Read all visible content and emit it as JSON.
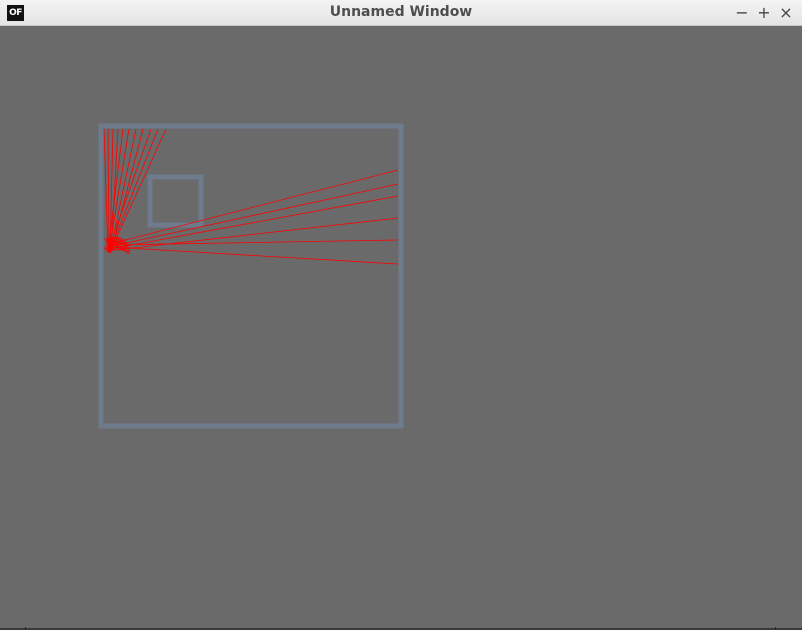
{
  "window": {
    "title": "Unnamed Window",
    "app_icon_text": "OF",
    "controls": {
      "minimize": "−",
      "maximize": "+",
      "close": "×"
    }
  },
  "scene": {
    "background_color": "#6a6a6a",
    "frame_color": "#6d7b8d",
    "ray_color": "#ff0000"
  }
}
